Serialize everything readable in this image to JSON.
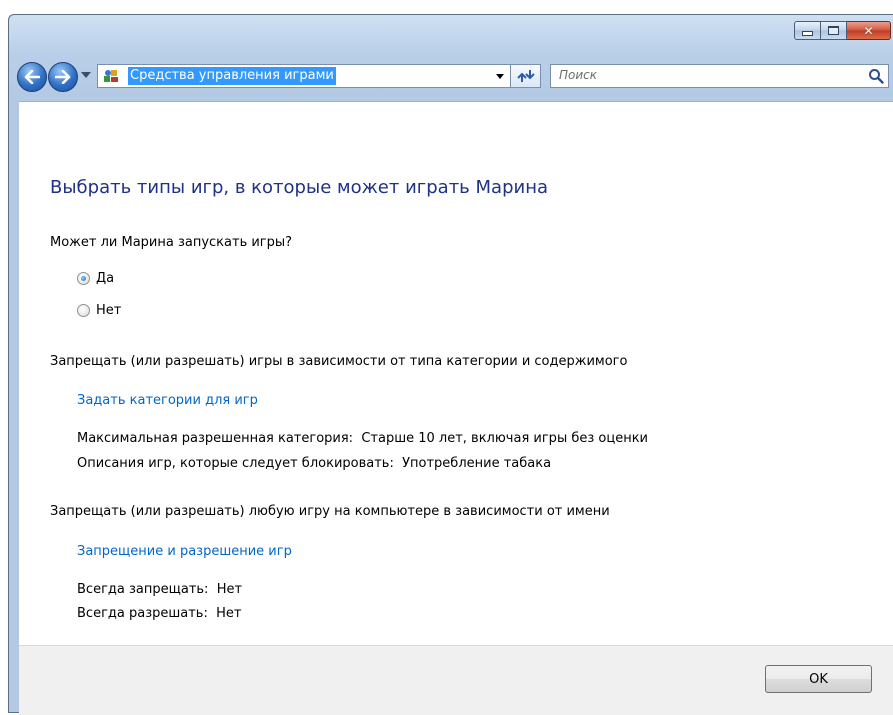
{
  "address": {
    "text": "Средства управления играми"
  },
  "search": {
    "placeholder": "Поиск"
  },
  "main": {
    "title": "Выбрать типы игр, в которые может играть Марина",
    "question": "Может ли Марина запускать игры?",
    "options": [
      {
        "label": "Да",
        "selected": true
      },
      {
        "label": "Нет",
        "selected": false
      }
    ],
    "category_section": {
      "heading": "Запрещать (или разрешать) игры в зависимости от типа категории и содержимого",
      "link": "Задать категории для игр",
      "max_rating_label": "Максимальная разрешенная категория:",
      "max_rating_value": "Старше 10 лет, включая игры без оценки",
      "blocked_desc_label": "Описания игр, которые следует блокировать:",
      "blocked_desc_value": "Употребление табака"
    },
    "name_section": {
      "heading": "Запрещать (или разрешать) любую игру на компьютере в зависимости от имени",
      "link": "Запрещение и разрешение игр",
      "always_block_label": "Всегда запрещать:",
      "always_block_value": "Нет",
      "always_allow_label": "Всегда разрешать:",
      "always_allow_value": "Нет"
    }
  },
  "footer": {
    "ok_label": "OK"
  },
  "icons": {
    "back": "back-arrow-icon",
    "forward": "forward-arrow-icon",
    "control_panel": "control-panel-icon",
    "refresh": "refresh-icon",
    "search": "search-icon",
    "minimize": "minimize-icon",
    "maximize": "maximize-icon",
    "close": "close-icon"
  },
  "colors": {
    "title": "#1e3287",
    "link": "#0066cc",
    "selection": "#3399ff",
    "close_button": "#c23a1f"
  }
}
